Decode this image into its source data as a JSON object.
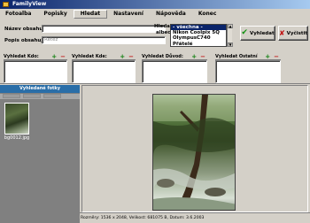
{
  "app": {
    "title": "FamilyView"
  },
  "menu": {
    "items": [
      {
        "label": "Fotoalba",
        "active": false
      },
      {
        "label": "Popisky",
        "active": false
      },
      {
        "label": "Hledat",
        "active": true
      },
      {
        "label": "Nastavení",
        "active": false
      },
      {
        "label": "Nápověda",
        "active": false
      },
      {
        "label": "Konec",
        "active": false
      }
    ]
  },
  "search": {
    "name_label": "Název obsahuje:",
    "name_value": "",
    "desc_label": "Popis obsahuje:",
    "desc_placeholder": "Retez",
    "albums_label_1": "Hledat v",
    "albums_label_2": "albech:",
    "albums": [
      {
        "label": "- všechna -",
        "selected": true
      },
      {
        "label": "Nikon Coolpix 5Q",
        "selected": false
      },
      {
        "label": "OlympusC740",
        "selected": false
      },
      {
        "label": "Přátelé",
        "selected": false
      }
    ],
    "search_button": "Vyhledat",
    "clear_button": "Vyčistit"
  },
  "filters": {
    "panels": [
      {
        "title": "Vyhledat Kdo:"
      },
      {
        "title": "Vyhledat Kde:"
      },
      {
        "title": "Vyhledat Důvod:"
      },
      {
        "title": "Vyhledat Ostatní"
      }
    ],
    "add_symbol": "+",
    "remove_symbol": "−"
  },
  "results": {
    "title": "Vyhledané fotky",
    "items": [
      {
        "filename": "bg0012.jpg"
      }
    ]
  },
  "status": {
    "text": "Rozměry: 1536 x 2048, Velikost: 681075 B, Datum: 3.6.2003"
  }
}
